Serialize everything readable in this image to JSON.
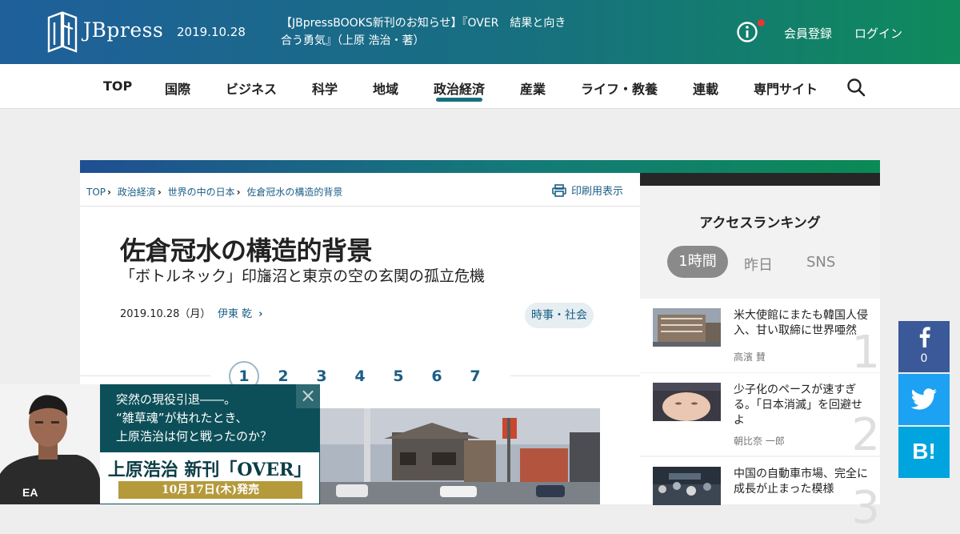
{
  "header": {
    "logo_text": "JBpress",
    "date": "2019.10.28",
    "news": "【JBpressBOOKS新刊のお知らせ】『OVER　結果と向き合う勇気』（上原 浩治・著）",
    "register": "会員登録",
    "login": "ログイン"
  },
  "nav": [
    "TOP",
    "国際",
    "ビジネス",
    "科学",
    "地域",
    "政治経済",
    "産業",
    "ライフ・教養",
    "連載",
    "専門サイト"
  ],
  "nav_active": "政治経済",
  "breadcrumb": [
    "TOP",
    "政治経済",
    "世界の中の日本",
    "佐倉冠水の構造的背景"
  ],
  "print_label": "印刷用表示",
  "article": {
    "title": "佐倉冠水の構造的背景",
    "subtitle": "「ボトルネック」印旛沼と東京の空の玄関の孤立危機",
    "date": "2019.10.28（月）",
    "author": "伊東 乾",
    "tag": "時事・社会",
    "pages": [
      "1",
      "2",
      "3",
      "4",
      "5",
      "6",
      "7"
    ],
    "current_page": "1"
  },
  "ranking": {
    "title": "アクセスランキング",
    "tabs": [
      "1時間",
      "昨日",
      "SNS"
    ],
    "items": [
      {
        "title": "米大使館にまたも韓国人侵入、甘い取締に世界唖然",
        "author": "高濱 賛",
        "rank": "1"
      },
      {
        "title": "少子化のペースが速すぎる。「日本消滅」を回避せよ",
        "author": "朝比奈 一郎",
        "rank": "2"
      },
      {
        "title": "中国の自動車市場、完全に成長が止まった模様",
        "author": "",
        "rank": "3"
      }
    ]
  },
  "share": {
    "facebook_count": "0",
    "hatena_label": "B!"
  },
  "promo": {
    "lines": [
      "突然の現役引退――。",
      "“雑草魂”が枯れたとき、",
      "上原浩治は何と戦ったのか？"
    ],
    "book": "上原浩治 新刊「OVER」",
    "release": "10月17日(木)発売"
  },
  "colors": {
    "accent": "#14707c",
    "link": "#1b5f86",
    "facebook": "#3b5998",
    "twitter": "#1da1f2",
    "hatena": "#00a4de"
  }
}
